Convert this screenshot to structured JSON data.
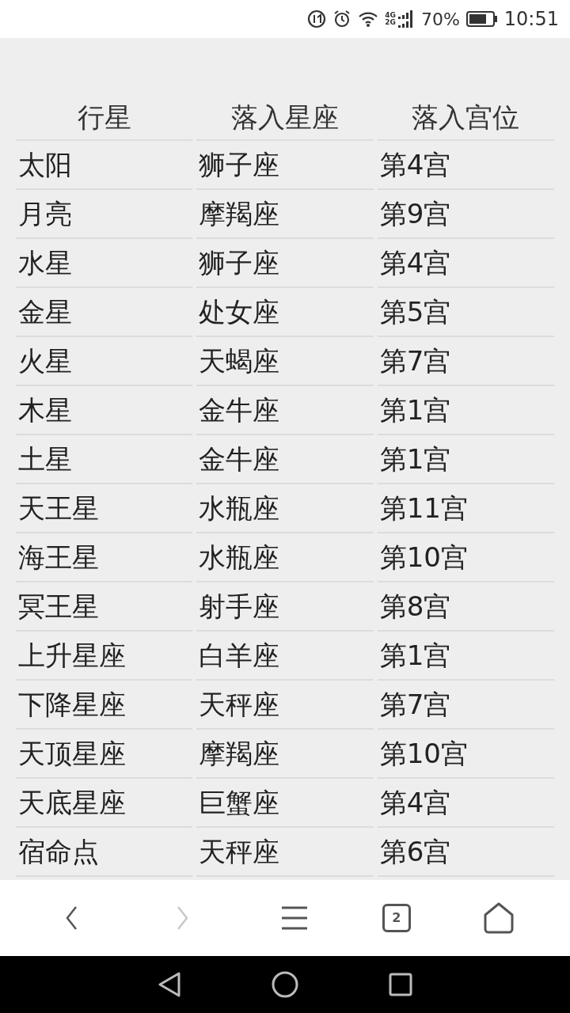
{
  "status_bar": {
    "network_top": "4G",
    "network_bottom": "2G",
    "battery": "70%",
    "time": "10:51"
  },
  "table": {
    "columns": [
      "行星",
      "落入星座",
      "落入宫位"
    ],
    "rows": [
      [
        "太阳",
        "狮子座",
        "第4宫"
      ],
      [
        "月亮",
        "摩羯座",
        "第9宫"
      ],
      [
        "水星",
        "狮子座",
        "第4宫"
      ],
      [
        "金星",
        "处女座",
        "第5宫"
      ],
      [
        "火星",
        "天蝎座",
        "第7宫"
      ],
      [
        "木星",
        "金牛座",
        "第1宫"
      ],
      [
        "土星",
        "金牛座",
        "第1宫"
      ],
      [
        "天王星",
        "水瓶座",
        "第11宫"
      ],
      [
        "海王星",
        "水瓶座",
        "第10宫"
      ],
      [
        "冥王星",
        "射手座",
        "第8宫"
      ],
      [
        "上升星座",
        "白羊座",
        "第1宫"
      ],
      [
        "下降星座",
        "天秤座",
        "第7宫"
      ],
      [
        "天顶星座",
        "摩羯座",
        "第10宫"
      ],
      [
        "天底星座",
        "巨蟹座",
        "第4宫"
      ],
      [
        "宿命点",
        "天秤座",
        "第6宫"
      ]
    ]
  },
  "browser_toolbar": {
    "back_disabled": false,
    "forward_disabled": true,
    "tab_count": "2"
  }
}
